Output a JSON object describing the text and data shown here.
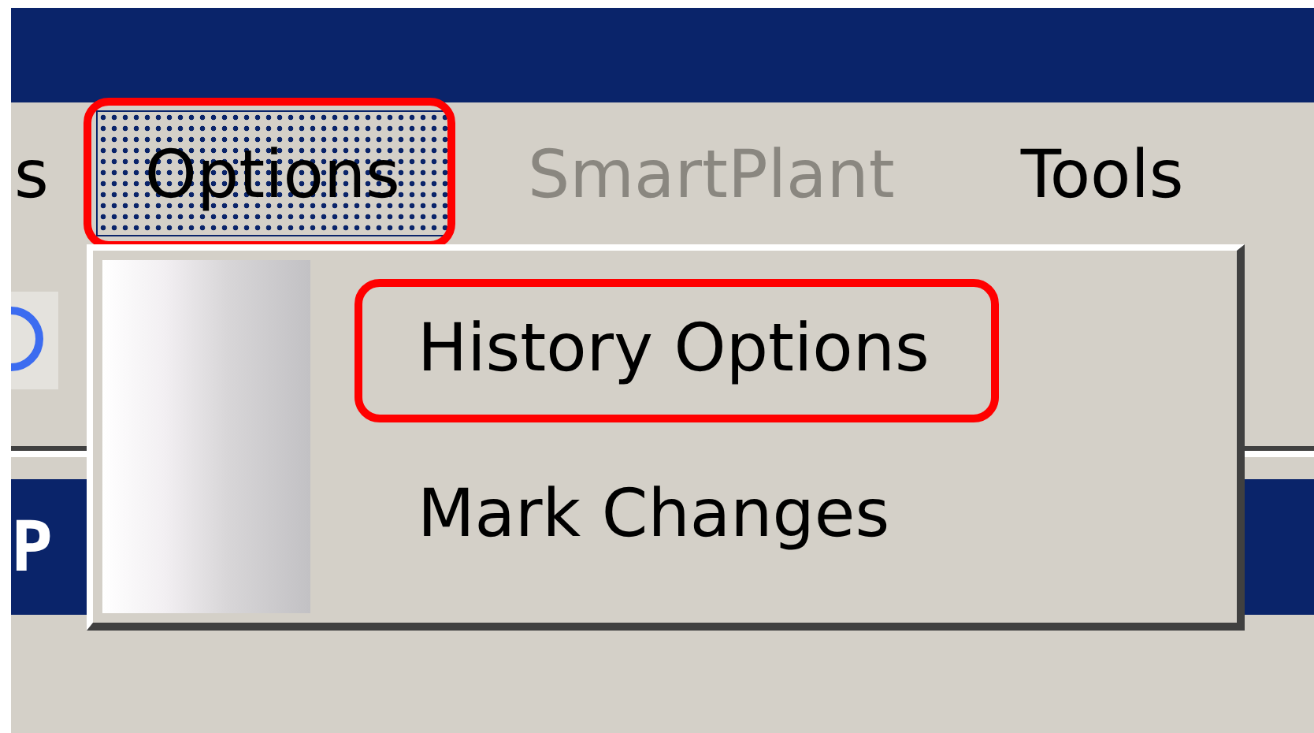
{
  "menu_bar": {
    "items": [
      {
        "label": "s",
        "selected": false,
        "disabled": false,
        "annotated": false
      },
      {
        "label": "Options",
        "selected": true,
        "disabled": false,
        "annotated": true
      },
      {
        "label": "SmartPlant",
        "selected": false,
        "disabled": true,
        "annotated": false
      },
      {
        "label": "Tools",
        "selected": false,
        "disabled": false,
        "annotated": false
      }
    ]
  },
  "dropdown": {
    "items": [
      {
        "label": "History Options",
        "annotated": true
      },
      {
        "label": "Mark Changes",
        "annotated": false
      }
    ]
  },
  "panel_header": {
    "text": "P"
  }
}
